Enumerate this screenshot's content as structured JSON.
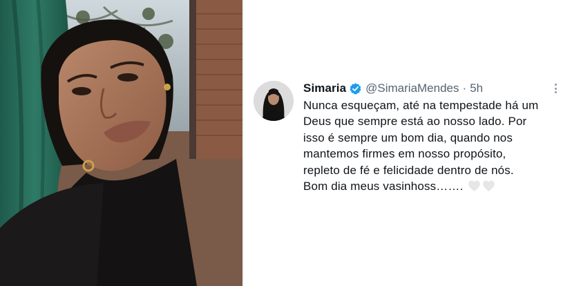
{
  "tweet": {
    "display_name": "Simaria",
    "handle": "@SimariaMendes",
    "separator": "·",
    "time": "5h",
    "lines": [
      "Nunca esqueçam, até na tempestade há um",
      "Deus que sempre está ao nosso lado. Por",
      "isso é sempre um bom dia, quando nos",
      "mantemos firmes em nosso propósito,",
      "repleto de fé e felicidade dentro de nós.",
      "Bom dia meus vasinhoss……."
    ],
    "emojis": [
      "white-heart-icon",
      "white-heart-icon"
    ]
  },
  "colors": {
    "name_text": "#0f1419",
    "secondary_text": "#536471",
    "verified_badge": "#1d9bf0",
    "heart": "#e6e6e6"
  }
}
